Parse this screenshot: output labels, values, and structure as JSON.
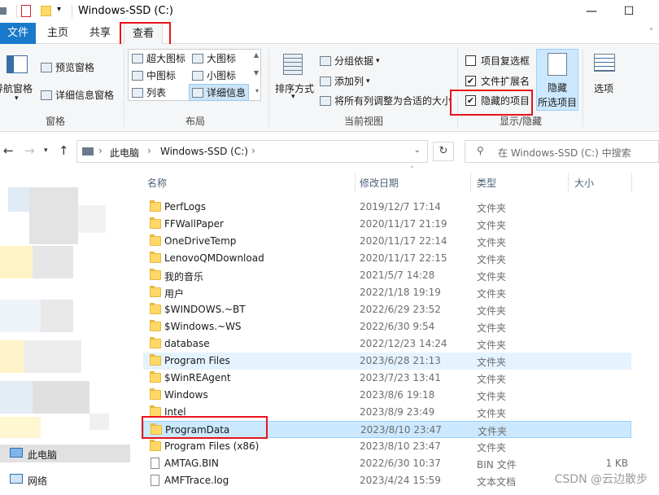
{
  "window": {
    "title": "Windows-SSD (C:)",
    "minimize": "—",
    "maximize": "☐"
  },
  "tabs": [
    {
      "label": "文件",
      "selected": false
    },
    {
      "label": "主页",
      "selected": false
    },
    {
      "label": "共享",
      "selected": false
    },
    {
      "label": "查看",
      "selected": true
    }
  ],
  "ribbon": {
    "panes": {
      "nav_pane_label": "导航窗格",
      "preview_pane_label": "预览窗格",
      "details_pane_label": "详细信息窗格",
      "group_label": "窗格"
    },
    "layout": {
      "items": [
        "超大图标",
        "大图标",
        "中图标",
        "小图标",
        "列表",
        "详细信息"
      ],
      "selected": "详细信息",
      "group_label": "布局"
    },
    "current_view": {
      "sort_label": "排序方式",
      "group_by_label": "分组依据",
      "add_column_label": "添加列",
      "fit_columns_label": "将所有列调整为合适的大小",
      "group_label": "当前视图"
    },
    "show_hide": {
      "item_checkboxes_label": "项目复选框",
      "item_checkboxes_checked": false,
      "file_extensions_label": "文件扩展名",
      "file_extensions_checked": true,
      "hidden_items_label": "隐藏的项目",
      "hidden_items_checked": true,
      "hide_selected_label_1": "隐藏",
      "hide_selected_label_2": "所选项目",
      "group_label": "显示/隐藏"
    },
    "options_label": "选项"
  },
  "address": {
    "path": [
      "此电脑",
      "Windows-SSD (C:)"
    ],
    "search_placeholder": "在 Windows-SSD (C:) 中搜索"
  },
  "columns": {
    "name": "名称",
    "date": "修改日期",
    "type": "类型",
    "size": "大小"
  },
  "files": [
    {
      "name": "PerfLogs",
      "date": "2019/12/7 17:14",
      "type": "文件夹",
      "size": "",
      "kind": "folder"
    },
    {
      "name": "FFWallPaper",
      "date": "2020/11/17 21:19",
      "type": "文件夹",
      "size": "",
      "kind": "folder"
    },
    {
      "name": "OneDriveTemp",
      "date": "2020/11/17 22:14",
      "type": "文件夹",
      "size": "",
      "kind": "folder"
    },
    {
      "name": "LenovoQMDownload",
      "date": "2020/11/17 22:15",
      "type": "文件夹",
      "size": "",
      "kind": "folder"
    },
    {
      "name": "我的音乐",
      "date": "2021/5/7 14:28",
      "type": "文件夹",
      "size": "",
      "kind": "folder"
    },
    {
      "name": "用户",
      "date": "2022/1/18 19:19",
      "type": "文件夹",
      "size": "",
      "kind": "folder"
    },
    {
      "name": "$WINDOWS.~BT",
      "date": "2022/6/29 23:52",
      "type": "文件夹",
      "size": "",
      "kind": "folder"
    },
    {
      "name": "$Windows.~WS",
      "date": "2022/6/30 9:54",
      "type": "文件夹",
      "size": "",
      "kind": "folder"
    },
    {
      "name": "database",
      "date": "2022/12/23 14:24",
      "type": "文件夹",
      "size": "",
      "kind": "folder"
    },
    {
      "name": "Program Files",
      "date": "2023/6/28 21:13",
      "type": "文件夹",
      "size": "",
      "kind": "folder",
      "state": "hover"
    },
    {
      "name": "$WinREAgent",
      "date": "2023/7/23 13:41",
      "type": "文件夹",
      "size": "",
      "kind": "folder"
    },
    {
      "name": "Windows",
      "date": "2023/8/6 19:18",
      "type": "文件夹",
      "size": "",
      "kind": "folder"
    },
    {
      "name": "Intel",
      "date": "2023/8/9 23:49",
      "type": "文件夹",
      "size": "",
      "kind": "folder"
    },
    {
      "name": "ProgramData",
      "date": "2023/8/10 23:47",
      "type": "文件夹",
      "size": "",
      "kind": "folder",
      "state": "selected"
    },
    {
      "name": "Program Files (x86)",
      "date": "2023/8/10 23:47",
      "type": "文件夹",
      "size": "",
      "kind": "folder"
    },
    {
      "name": "AMTAG.BIN",
      "date": "2022/6/30 10:37",
      "type": "BIN 文件",
      "size": "1 KB",
      "kind": "file"
    },
    {
      "name": "AMFTrace.log",
      "date": "2023/4/24 15:59",
      "type": "文本文档",
      "size": "",
      "kind": "file"
    }
  ],
  "nav_pane": {
    "this_pc": "此电脑",
    "network": "网络"
  },
  "watermark": "CSDN @云边散步"
}
